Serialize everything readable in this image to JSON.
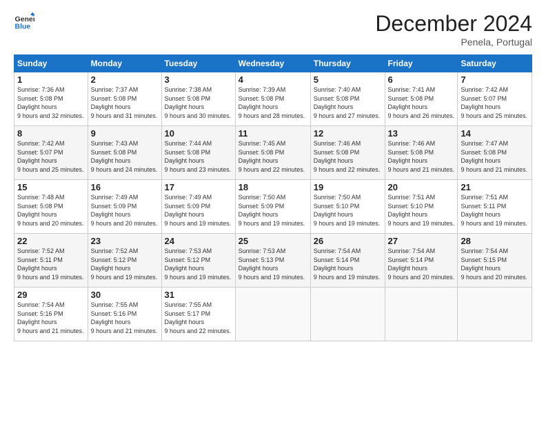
{
  "logo": {
    "line1": "General",
    "line2": "Blue"
  },
  "title": "December 2024",
  "location": "Penela, Portugal",
  "days_header": [
    "Sunday",
    "Monday",
    "Tuesday",
    "Wednesday",
    "Thursday",
    "Friday",
    "Saturday"
  ],
  "weeks": [
    [
      {
        "day": "1",
        "sunrise": "7:36 AM",
        "sunset": "5:08 PM",
        "daylight": "9 hours and 32 minutes."
      },
      {
        "day": "2",
        "sunrise": "7:37 AM",
        "sunset": "5:08 PM",
        "daylight": "9 hours and 31 minutes."
      },
      {
        "day": "3",
        "sunrise": "7:38 AM",
        "sunset": "5:08 PM",
        "daylight": "9 hours and 30 minutes."
      },
      {
        "day": "4",
        "sunrise": "7:39 AM",
        "sunset": "5:08 PM",
        "daylight": "9 hours and 28 minutes."
      },
      {
        "day": "5",
        "sunrise": "7:40 AM",
        "sunset": "5:08 PM",
        "daylight": "9 hours and 27 minutes."
      },
      {
        "day": "6",
        "sunrise": "7:41 AM",
        "sunset": "5:08 PM",
        "daylight": "9 hours and 26 minutes."
      },
      {
        "day": "7",
        "sunrise": "7:42 AM",
        "sunset": "5:07 PM",
        "daylight": "9 hours and 25 minutes."
      }
    ],
    [
      {
        "day": "8",
        "sunrise": "7:42 AM",
        "sunset": "5:07 PM",
        "daylight": "9 hours and 25 minutes."
      },
      {
        "day": "9",
        "sunrise": "7:43 AM",
        "sunset": "5:08 PM",
        "daylight": "9 hours and 24 minutes."
      },
      {
        "day": "10",
        "sunrise": "7:44 AM",
        "sunset": "5:08 PM",
        "daylight": "9 hours and 23 minutes."
      },
      {
        "day": "11",
        "sunrise": "7:45 AM",
        "sunset": "5:08 PM",
        "daylight": "9 hours and 22 minutes."
      },
      {
        "day": "12",
        "sunrise": "7:46 AM",
        "sunset": "5:08 PM",
        "daylight": "9 hours and 22 minutes."
      },
      {
        "day": "13",
        "sunrise": "7:46 AM",
        "sunset": "5:08 PM",
        "daylight": "9 hours and 21 minutes."
      },
      {
        "day": "14",
        "sunrise": "7:47 AM",
        "sunset": "5:08 PM",
        "daylight": "9 hours and 21 minutes."
      }
    ],
    [
      {
        "day": "15",
        "sunrise": "7:48 AM",
        "sunset": "5:08 PM",
        "daylight": "9 hours and 20 minutes."
      },
      {
        "day": "16",
        "sunrise": "7:49 AM",
        "sunset": "5:09 PM",
        "daylight": "9 hours and 20 minutes."
      },
      {
        "day": "17",
        "sunrise": "7:49 AM",
        "sunset": "5:09 PM",
        "daylight": "9 hours and 19 minutes."
      },
      {
        "day": "18",
        "sunrise": "7:50 AM",
        "sunset": "5:09 PM",
        "daylight": "9 hours and 19 minutes."
      },
      {
        "day": "19",
        "sunrise": "7:50 AM",
        "sunset": "5:10 PM",
        "daylight": "9 hours and 19 minutes."
      },
      {
        "day": "20",
        "sunrise": "7:51 AM",
        "sunset": "5:10 PM",
        "daylight": "9 hours and 19 minutes."
      },
      {
        "day": "21",
        "sunrise": "7:51 AM",
        "sunset": "5:11 PM",
        "daylight": "9 hours and 19 minutes."
      }
    ],
    [
      {
        "day": "22",
        "sunrise": "7:52 AM",
        "sunset": "5:11 PM",
        "daylight": "9 hours and 19 minutes."
      },
      {
        "day": "23",
        "sunrise": "7:52 AM",
        "sunset": "5:12 PM",
        "daylight": "9 hours and 19 minutes."
      },
      {
        "day": "24",
        "sunrise": "7:53 AM",
        "sunset": "5:12 PM",
        "daylight": "9 hours and 19 minutes."
      },
      {
        "day": "25",
        "sunrise": "7:53 AM",
        "sunset": "5:13 PM",
        "daylight": "9 hours and 19 minutes."
      },
      {
        "day": "26",
        "sunrise": "7:54 AM",
        "sunset": "5:14 PM",
        "daylight": "9 hours and 19 minutes."
      },
      {
        "day": "27",
        "sunrise": "7:54 AM",
        "sunset": "5:14 PM",
        "daylight": "9 hours and 20 minutes."
      },
      {
        "day": "28",
        "sunrise": "7:54 AM",
        "sunset": "5:15 PM",
        "daylight": "9 hours and 20 minutes."
      }
    ],
    [
      {
        "day": "29",
        "sunrise": "7:54 AM",
        "sunset": "5:16 PM",
        "daylight": "9 hours and 21 minutes."
      },
      {
        "day": "30",
        "sunrise": "7:55 AM",
        "sunset": "5:16 PM",
        "daylight": "9 hours and 21 minutes."
      },
      {
        "day": "31",
        "sunrise": "7:55 AM",
        "sunset": "5:17 PM",
        "daylight": "9 hours and 22 minutes."
      },
      null,
      null,
      null,
      null
    ]
  ]
}
